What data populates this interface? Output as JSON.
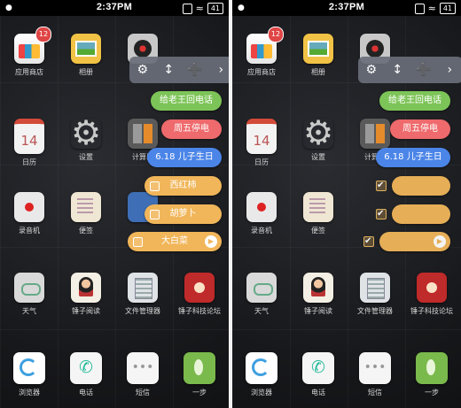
{
  "status": {
    "time": "2:37PM",
    "battery": "41"
  },
  "apps": {
    "store": "应用商店",
    "store_badge": "12",
    "photos": "相册",
    "music": "音乐",
    "calendar": "日历",
    "calendar_day": "14",
    "settings": "设置",
    "calculator": "计算器",
    "recorder": "录音机",
    "notes": "便签",
    "weather": "天气",
    "reader": "锤子阅读",
    "files": "文件管理器",
    "forum": "锤子科技论坛",
    "browser": "浏览器",
    "phone": "电话",
    "sms": "短信",
    "step": "一步"
  },
  "toolbar": {
    "icons": [
      "gear-icon",
      "sort-icon",
      "add-icon",
      "chevron-right-icon"
    ]
  },
  "reminders": {
    "r1": "给老王回电话",
    "r2": "周五停电",
    "r3": "6.18 儿子生日",
    "t1": "西红柿",
    "t2": "胡萝卜",
    "t3": "大白菜"
  },
  "colors": {
    "green": "#7dc458",
    "red": "#ee6a6c",
    "blue": "#4b85e8",
    "orange": "#f1b65a"
  }
}
